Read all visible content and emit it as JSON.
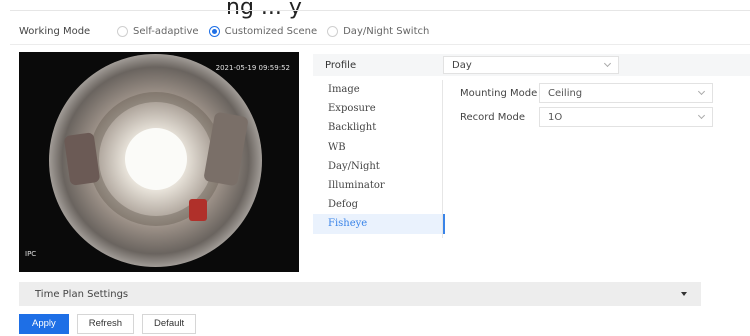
{
  "header": {
    "title_fragment": "ng ... y"
  },
  "working_mode": {
    "label": "Working Mode",
    "options": [
      {
        "label": "Self-adaptive",
        "selected": false
      },
      {
        "label": "Customized Scene",
        "selected": true
      },
      {
        "label": "Day/Night Switch",
        "selected": false
      }
    ]
  },
  "video": {
    "timestamp": "2021-05-19 09:59:52",
    "channel": "IPC"
  },
  "profile": {
    "label": "Profile",
    "value": "Day"
  },
  "tabs": [
    "Image",
    "Exposure",
    "Backlight",
    "WB",
    "Day/Night",
    "Illuminator",
    "Defog",
    "Fisheye"
  ],
  "active_tab": "Fisheye",
  "fisheye": {
    "mounting_mode": {
      "label": "Mounting Mode",
      "value": "Ceiling"
    },
    "record_mode": {
      "label": "Record Mode",
      "value": "1O"
    }
  },
  "time_plan": {
    "label": "Time Plan Settings"
  },
  "buttons": {
    "apply": "Apply",
    "refresh": "Refresh",
    "default": "Default"
  },
  "colors": {
    "accent": "#1e6fe6",
    "tab_active_bg": "#eaf2fd",
    "section_bar": "#ededed"
  }
}
